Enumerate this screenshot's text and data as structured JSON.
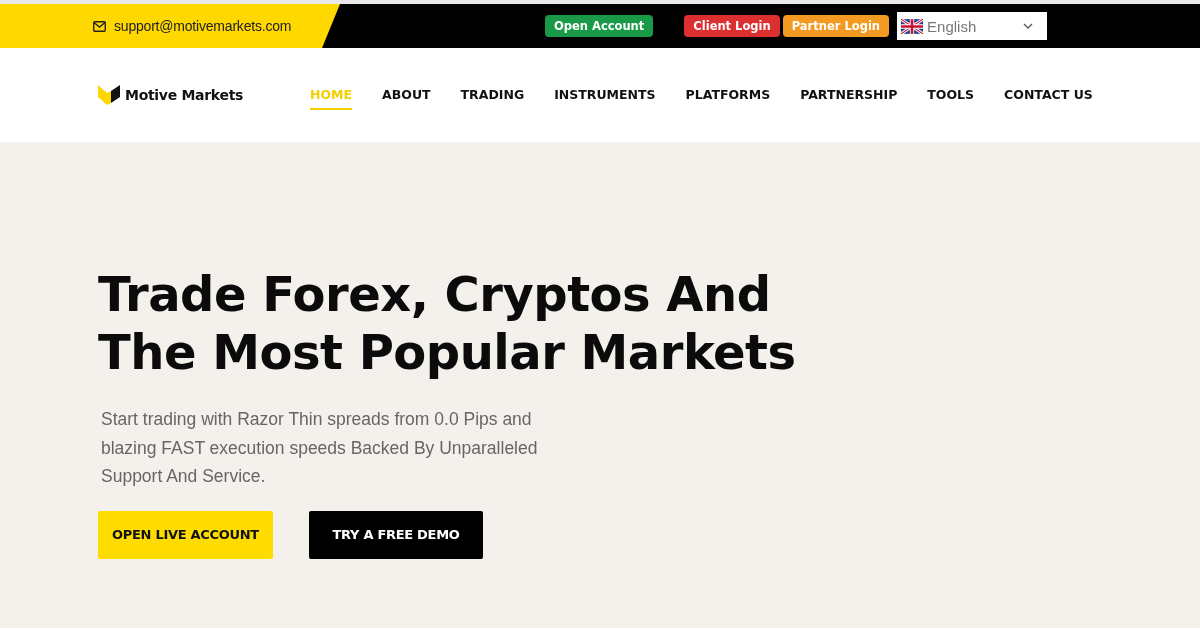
{
  "top_bar": {
    "email": "support@motivemarkets.com",
    "buttons": [
      {
        "label": "Open Account",
        "color": "#1a9a48"
      },
      {
        "label": "Client Login",
        "color": "#dc2f2f"
      },
      {
        "label": "Partner Login",
        "color": "#f39a22"
      }
    ],
    "language": {
      "value": "English"
    }
  },
  "header": {
    "logo": "Motive Markets",
    "nav": [
      {
        "label": "HOME",
        "selected": true
      },
      {
        "label": "ABOUT",
        "selected": false
      },
      {
        "label": "TRADING",
        "selected": false
      },
      {
        "label": "INSTRUMENTS",
        "selected": false
      },
      {
        "label": "PLATFORMS",
        "selected": false
      },
      {
        "label": "PARTNERSHIP",
        "selected": false
      },
      {
        "label": "TOOLS",
        "selected": false
      },
      {
        "label": "CONTACT US",
        "selected": false
      }
    ]
  },
  "hero": {
    "heading_lines": [
      "Trade Forex, Cryptos And",
      "The Most Popular Markets"
    ],
    "text": "Start trading with Razor Thin spreads from 0.0 Pips and blazing FAST execution speeds Backed By Unparalleled Support And Service.",
    "buttons": [
      {
        "label": "OPEN LIVE ACCOUNT",
        "kind": "primary"
      },
      {
        "label": "TRY A FREE DEMO",
        "kind": "dark"
      }
    ]
  }
}
